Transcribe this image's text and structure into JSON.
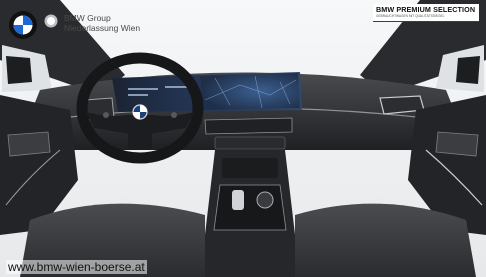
{
  "image": {
    "alt": "BMW 3 Series interior with curved display",
    "overlays": {
      "dealer_name_line1": "BMW Group",
      "dealer_name_line2": "Niederlassung Wien",
      "badge_title": "BMW PREMIUM SELECTION",
      "badge_subtitle": "GEBRAUCHTWAGEN MIT QUALITÄTSSIEGEL",
      "website": "www.bmw-wien-boerse.at"
    }
  },
  "colors": {
    "interior_dark": "#1f1f22",
    "seat_fabric": "#3a3b3e",
    "accent_chrome": "#c9ccd1",
    "screen_blue": "#2a3b5c",
    "badge_accent": "#cc0000"
  }
}
